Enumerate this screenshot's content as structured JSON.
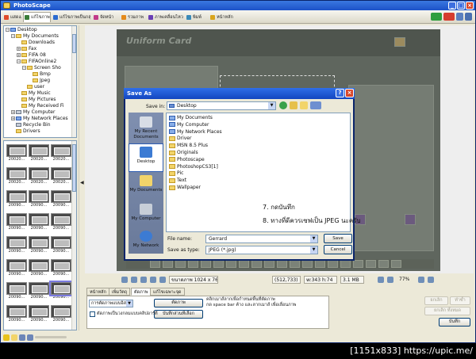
{
  "window": {
    "title": "PhotoScape",
    "controls": [
      "_",
      "□",
      "×"
    ]
  },
  "tabs": [
    {
      "label": "แสดงภาพ",
      "color": "#e04a2a"
    },
    {
      "label": "แก้ไขภาพ",
      "color": "#3a7d3a",
      "active": true
    },
    {
      "label": "แก้ไขภาพเป็นกลุ่ม",
      "color": "#2b6bd0"
    },
    {
      "label": "จัดหน้า",
      "color": "#c23b8a"
    },
    {
      "label": "รวมภาพ",
      "color": "#e48a1a"
    },
    {
      "label": "ภาพเคลื่อนไหว",
      "color": "#6a3fb5"
    },
    {
      "label": "พิมพ์",
      "color": "#3a8ab8"
    },
    {
      "label": "หน้าหลัก",
      "color": "#d9a51c"
    }
  ],
  "header_badges": [
    {
      "icon": "new-badge-icon",
      "color": "#2f9e3f"
    },
    {
      "icon": "exif-badge-icon",
      "color": "#d63d2e"
    },
    {
      "icon": "settings-icon",
      "color": "#5b7fbf"
    },
    {
      "icon": "help-icon",
      "color": "#4a6fb0"
    }
  ],
  "folder_tree": [
    {
      "label": "Desktop",
      "level": 0,
      "expander": "-",
      "icon": "blue"
    },
    {
      "label": "My Documents",
      "level": 1,
      "expander": "-",
      "icon": "folder"
    },
    {
      "label": "Downloads",
      "level": 2,
      "expander": "",
      "icon": "folder"
    },
    {
      "label": "Fax",
      "level": 2,
      "expander": "+",
      "icon": "folder"
    },
    {
      "label": "FIFA 08",
      "level": 2,
      "expander": "+",
      "icon": "folder"
    },
    {
      "label": "FIFAOnline2",
      "level": 2,
      "expander": "-",
      "icon": "folder"
    },
    {
      "label": "Screen Sho",
      "level": 3,
      "expander": "-",
      "icon": "folder"
    },
    {
      "label": "Bmp",
      "level": 4,
      "expander": "",
      "icon": "folder"
    },
    {
      "label": "Jpeg",
      "level": 4,
      "expander": "",
      "icon": "folder"
    },
    {
      "label": "user",
      "level": 3,
      "expander": "",
      "icon": "folder"
    },
    {
      "label": "My Music",
      "level": 2,
      "expander": "",
      "icon": "folder"
    },
    {
      "label": "My Pictures",
      "level": 2,
      "expander": "",
      "icon": "folder"
    },
    {
      "label": "My Received Fi",
      "level": 2,
      "expander": "",
      "icon": "folder"
    },
    {
      "label": "My Computer",
      "level": 1,
      "expander": "+",
      "icon": "drive"
    },
    {
      "label": "My Network Places",
      "level": 1,
      "expander": "+",
      "icon": "blue"
    },
    {
      "label": "Recycle Bin",
      "level": 1,
      "expander": "",
      "icon": "drive"
    },
    {
      "label": "Drivers",
      "level": 1,
      "expander": "",
      "icon": "folder"
    }
  ],
  "thumbnails": [
    "20020...",
    "20020...",
    "20020...",
    "20020...",
    "20020...",
    "20020...",
    "20090...",
    "20090...",
    "20090...",
    "20090...",
    "20090...",
    "20090...",
    "20090...",
    "20090...",
    "20090...",
    "20090...",
    "20090...",
    "20090...",
    "20090...",
    "20090...",
    "20090...",
    "20090...",
    "20090...",
    "20090..."
  ],
  "canvas": {
    "banner": "Uniform Card"
  },
  "statusbar": {
    "dimensions": "ขนาดภาพ 1024 x 768",
    "coords": "(512,733)",
    "selection": "w:343 h:74",
    "filesize": "3.1 MB",
    "zoom": "77%"
  },
  "bottom_tabs": [
    {
      "label": "หน้าหลัก",
      "active": false
    },
    {
      "label": "เพิ่มวัตถุ",
      "active": false
    },
    {
      "label": "ตัดภาพ",
      "active": true
    },
    {
      "label": "แก้ไขเฉพาะจุด",
      "active": false
    }
  ],
  "crop_panel": {
    "mode_select": "การตัดภาพแบบอิสระ",
    "crop_button": "ตัดภาพ",
    "save_crop_button": "บันทึกส่วนที่เลือก",
    "checkbox_label": "ตัดภาพเป็นวงกลมแบบคลิปอาร์ตี",
    "hint_line1": "คลิกเมาส์ลากเพื่อกำหนดพื้นที่ตัดภาพ",
    "hint_line2": "กด space bar ค้าง และลากเมาส์ เพื่อเลื่อนภาพ"
  },
  "right_buttons": {
    "undo": "ยกเลิก",
    "redo": "ทำซ้ำ",
    "undo_all": "ยกเลิก ทั้งหมด",
    "save": "บันทึก"
  },
  "dialog": {
    "title": "Save As",
    "save_in_label": "Save in:",
    "save_in_value": "Desktop",
    "places": [
      "My Recent Documents",
      "Desktop",
      "My Documents",
      "My Computer",
      "My Network"
    ],
    "files": [
      {
        "name": "My Documents",
        "type": "sys"
      },
      {
        "name": "My Computer",
        "type": "sys"
      },
      {
        "name": "My Network Places",
        "type": "sys"
      },
      {
        "name": "Driver",
        "type": "folder"
      },
      {
        "name": "MSN 8.5 Plus",
        "type": "folder"
      },
      {
        "name": "Originals",
        "type": "folder"
      },
      {
        "name": "Photoscape",
        "type": "folder"
      },
      {
        "name": "PhotoshopCS3[1]",
        "type": "folder"
      },
      {
        "name": "Pic",
        "type": "folder"
      },
      {
        "name": "Text",
        "type": "folder"
      },
      {
        "name": "Wallpaper",
        "type": "folder"
      }
    ],
    "instruction_7": "7. กดบันทึก",
    "instruction_8": "8. ทางที่ดีควรเซฟเป็น JPEG นะครับ",
    "filename_label": "File name:",
    "filename_value": "Gerrard",
    "filetype_label": "Save as type:",
    "filetype_value": "JPEG (*.jpg)",
    "save_button": "Save",
    "cancel_button": "Cancel"
  },
  "caption": "[1151x833] https://upic.me/"
}
